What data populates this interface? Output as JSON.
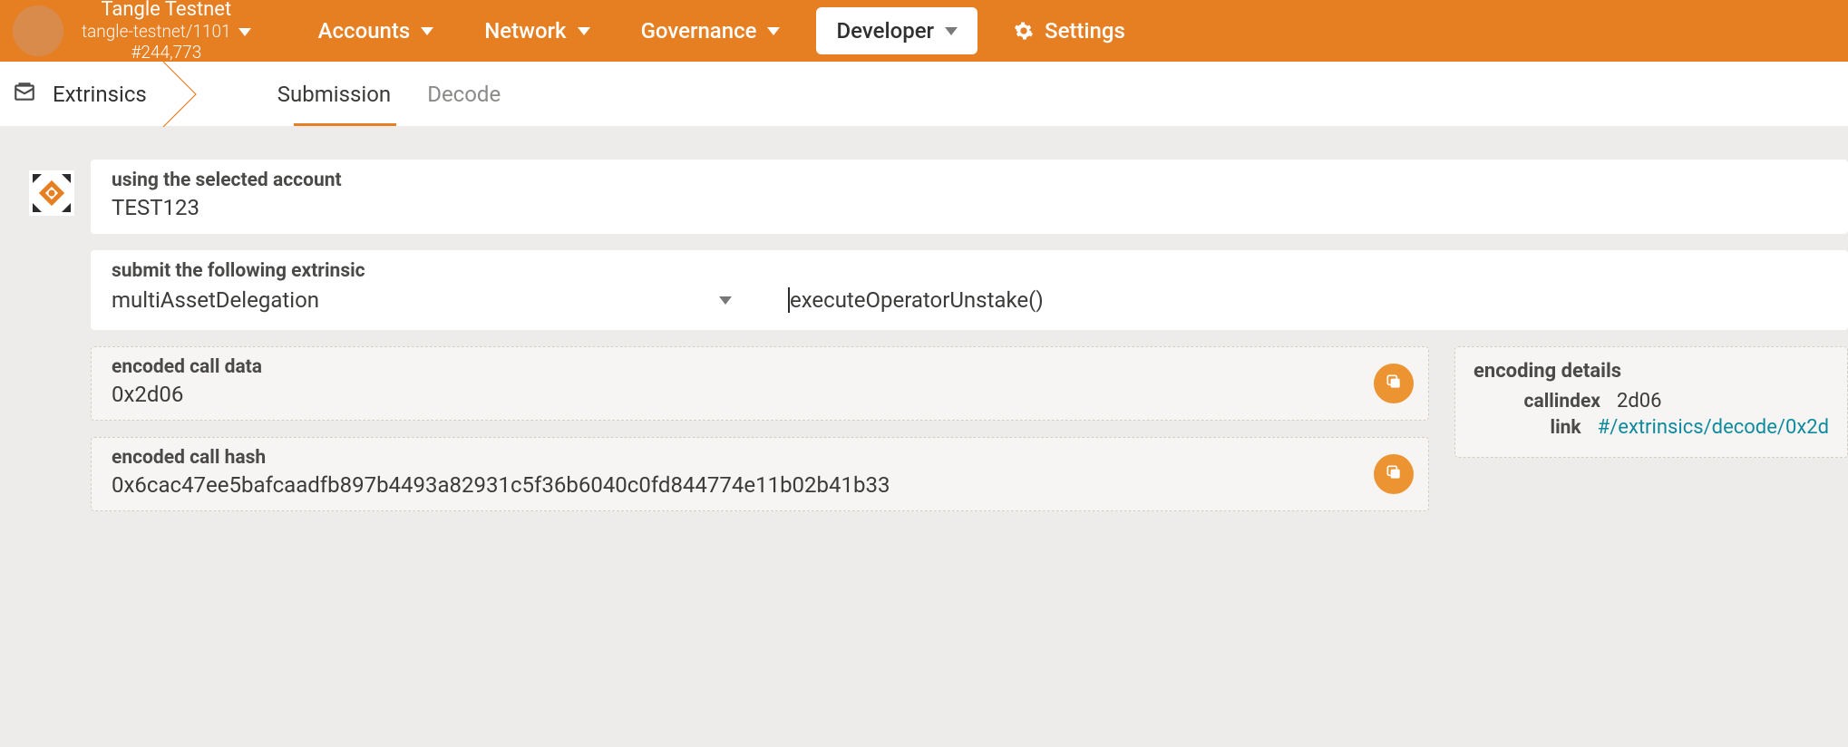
{
  "colors": {
    "accent": "#e67e22",
    "link": "#0e8a9e"
  },
  "header": {
    "chain_title": "Tangle Testnet",
    "chain_subtitle": "tangle-testnet/1101",
    "block_number": "#244,773",
    "nav": {
      "accounts": "Accounts",
      "network": "Network",
      "governance": "Governance",
      "developer": "Developer",
      "settings": "Settings"
    }
  },
  "subnav": {
    "page_title": "Extrinsics",
    "tabs": {
      "submission": "Submission",
      "decode": "Decode"
    }
  },
  "form": {
    "account_label": "using the selected account",
    "account_value": "TEST123",
    "submit_label": "submit the following extrinsic",
    "pallet": "multiAssetDelegation",
    "method": "executeOperatorUnstake()",
    "encoded_call_data_label": "encoded call data",
    "encoded_call_data": "0x2d06",
    "encoded_call_hash_label": "encoded call hash",
    "encoded_call_hash": "0x6cac47ee5bafcaadfb897b4493a82931c5f36b6040c0fd844774e11b02b41b33"
  },
  "details": {
    "title": "encoding details",
    "callindex_label": "callindex",
    "callindex_value": "2d06",
    "link_label": "link",
    "link_value": "#/extrinsics/decode/0x2d"
  }
}
